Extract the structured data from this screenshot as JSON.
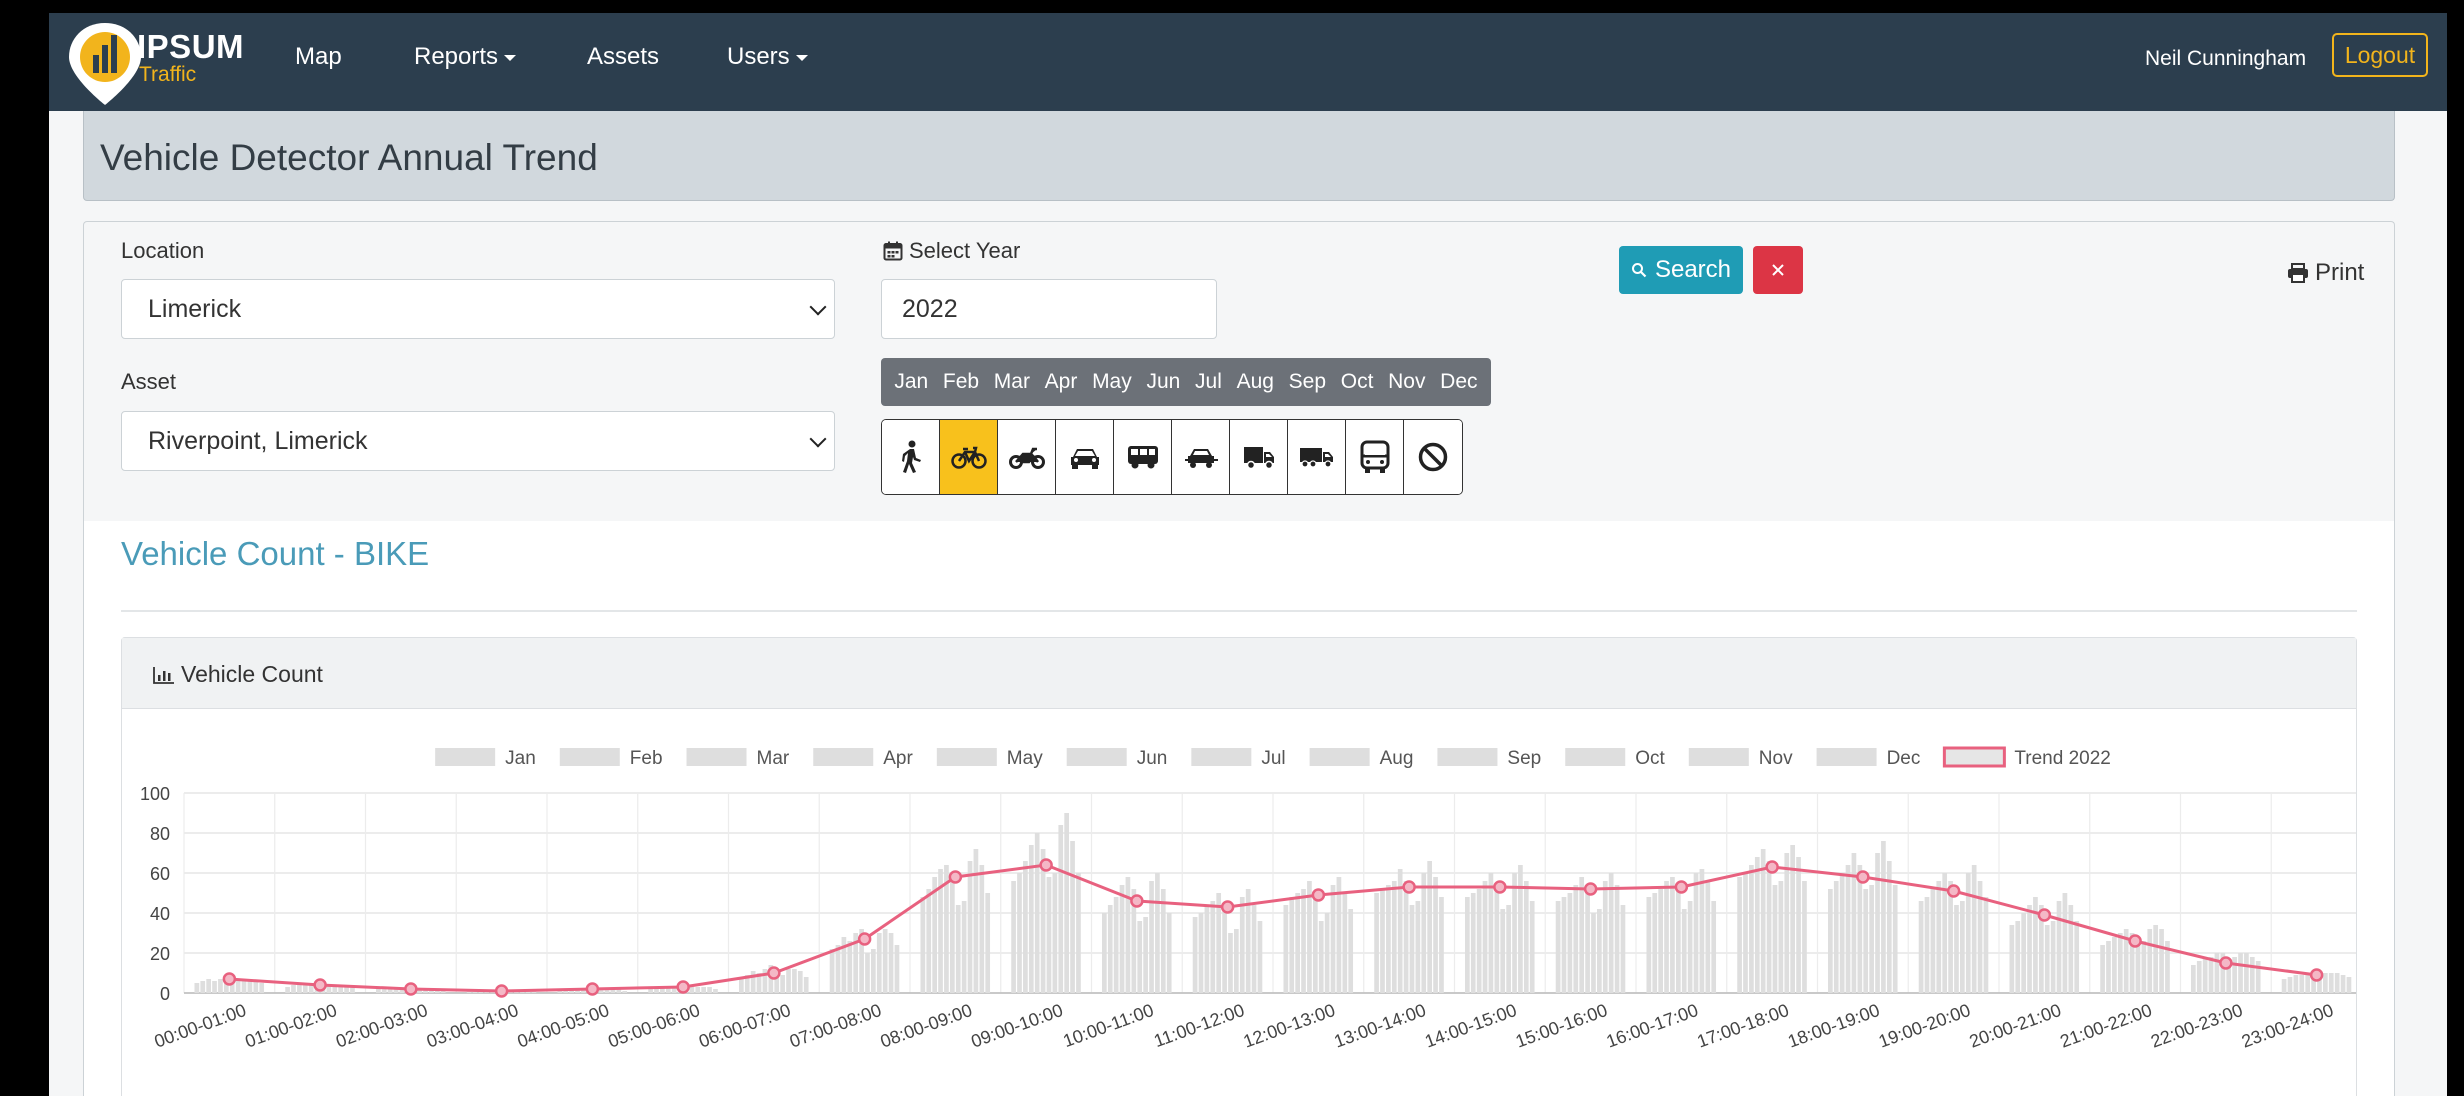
{
  "app": {
    "brand_name": "IPSUM",
    "brand_sub": "Traffic"
  },
  "nav": {
    "items": [
      {
        "label": "Map"
      },
      {
        "label": "Reports"
      },
      {
        "label": "Assets"
      },
      {
        "label": "Users"
      }
    ],
    "user_name": "Neil Cunningham",
    "logout_label": "Logout"
  },
  "page": {
    "title": "Vehicle Detector Annual Trend"
  },
  "filters": {
    "location_label": "Location",
    "location_value": "Limerick",
    "asset_label": "Asset",
    "asset_value": "Riverpoint, Limerick",
    "year_label": "Select Year",
    "year_value": "2022",
    "months": [
      "Jan",
      "Feb",
      "Mar",
      "Apr",
      "May",
      "Jun",
      "Jul",
      "Aug",
      "Sep",
      "Oct",
      "Nov",
      "Dec"
    ],
    "vehicle_types": [
      {
        "icon": "pedestrian-icon",
        "active": false
      },
      {
        "icon": "bicycle-icon",
        "active": true
      },
      {
        "icon": "motorcycle-icon",
        "active": false
      },
      {
        "icon": "car-icon",
        "active": false
      },
      {
        "icon": "van-icon",
        "active": false
      },
      {
        "icon": "car-trailer-icon",
        "active": false
      },
      {
        "icon": "truck-icon",
        "active": false
      },
      {
        "icon": "large-truck-icon",
        "active": false
      },
      {
        "icon": "bus-icon",
        "active": false
      },
      {
        "icon": "prohibited-icon",
        "active": false
      }
    ],
    "search_label": "Search",
    "print_label": "Print"
  },
  "section": {
    "title": "Vehicle Count - BIKE",
    "card_title": "Vehicle Count"
  },
  "colors": {
    "navbar": "#2c3e4e",
    "accent": "#f2b41c",
    "trend": "#e8617f",
    "bars": "#dedede",
    "search": "#1f9cb5",
    "clear": "#dc3545"
  },
  "chart_data": {
    "type": "bar",
    "categories": [
      "00:00-01:00",
      "01:00-02:00",
      "02:00-03:00",
      "03:00-04:00",
      "04:00-05:00",
      "05:00-06:00",
      "06:00-07:00",
      "07:00-08:00",
      "08:00-09:00",
      "09:00-10:00",
      "10:00-11:00",
      "11:00-12:00",
      "12:00-13:00",
      "13:00-14:00",
      "14:00-15:00",
      "15:00-16:00",
      "16:00-17:00",
      "17:00-18:00",
      "18:00-19:00",
      "19:00-20:00",
      "20:00-21:00",
      "21:00-22:00",
      "22:00-23:00",
      "23:00-24:00"
    ],
    "ylim": [
      0,
      100
    ],
    "yticks": [
      0,
      20,
      40,
      60,
      80,
      100
    ],
    "grid": true,
    "legend_position": "top-center",
    "series": [
      {
        "name": "Jan",
        "values": [
          5,
          3,
          2,
          1,
          1,
          2,
          8,
          22,
          48,
          56,
          40,
          38,
          44,
          50,
          48,
          46,
          48,
          58,
          52,
          46,
          34,
          24,
          14,
          7
        ]
      },
      {
        "name": "Feb",
        "values": [
          6,
          4,
          2,
          1,
          2,
          2,
          9,
          24,
          52,
          60,
          44,
          40,
          48,
          52,
          50,
          48,
          50,
          60,
          56,
          48,
          36,
          26,
          16,
          8
        ]
      },
      {
        "name": "Mar",
        "values": [
          7,
          4,
          2,
          1,
          2,
          3,
          11,
          28,
          58,
          66,
          48,
          44,
          50,
          54,
          52,
          50,
          52,
          64,
          60,
          52,
          40,
          28,
          18,
          9
        ]
      },
      {
        "name": "Apr",
        "values": [
          6,
          4,
          2,
          1,
          2,
          3,
          10,
          26,
          62,
          74,
          54,
          46,
          52,
          56,
          56,
          54,
          56,
          68,
          64,
          56,
          44,
          30,
          18,
          9
        ]
      },
      {
        "name": "May",
        "values": [
          7,
          5,
          2,
          1,
          2,
          3,
          12,
          30,
          64,
          80,
          58,
          50,
          56,
          62,
          60,
          58,
          58,
          72,
          70,
          60,
          48,
          32,
          20,
          10
        ]
      },
      {
        "name": "Jun",
        "values": [
          8,
          5,
          3,
          1,
          2,
          4,
          14,
          32,
          56,
          72,
          52,
          44,
          50,
          56,
          54,
          52,
          54,
          66,
          64,
          56,
          44,
          30,
          20,
          11
        ]
      },
      {
        "name": "Jul",
        "values": [
          7,
          5,
          2,
          1,
          2,
          3,
          10,
          20,
          44,
          58,
          36,
          30,
          36,
          44,
          42,
          40,
          42,
          54,
          52,
          44,
          34,
          26,
          16,
          10
        ]
      },
      {
        "name": "Aug",
        "values": [
          6,
          4,
          2,
          1,
          2,
          3,
          9,
          22,
          46,
          60,
          38,
          32,
          40,
          46,
          44,
          42,
          46,
          56,
          54,
          46,
          36,
          26,
          18,
          10
        ]
      },
      {
        "name": "Sep",
        "values": [
          7,
          4,
          2,
          1,
          2,
          3,
          12,
          30,
          66,
          84,
          56,
          48,
          54,
          60,
          60,
          56,
          60,
          70,
          70,
          60,
          46,
          32,
          20,
          10
        ]
      },
      {
        "name": "Oct",
        "values": [
          7,
          4,
          2,
          1,
          2,
          3,
          12,
          32,
          72,
          90,
          60,
          52,
          58,
          66,
          64,
          60,
          62,
          74,
          76,
          64,
          50,
          34,
          20,
          10
        ]
      },
      {
        "name": "Nov",
        "values": [
          6,
          4,
          2,
          1,
          2,
          3,
          11,
          30,
          64,
          76,
          52,
          44,
          50,
          58,
          56,
          54,
          56,
          68,
          66,
          56,
          44,
          32,
          18,
          9
        ]
      },
      {
        "name": "Dec",
        "values": [
          5,
          3,
          2,
          1,
          1,
          2,
          8,
          24,
          50,
          60,
          40,
          36,
          42,
          48,
          46,
          44,
          46,
          56,
          54,
          48,
          36,
          26,
          16,
          8
        ]
      },
      {
        "name": "Trend 2022",
        "type": "line",
        "values": [
          7,
          4,
          2,
          1,
          2,
          3,
          10,
          27,
          58,
          64,
          46,
          43,
          49,
          53,
          53,
          52,
          53,
          63,
          58,
          51,
          39,
          26,
          15,
          9
        ]
      }
    ]
  }
}
